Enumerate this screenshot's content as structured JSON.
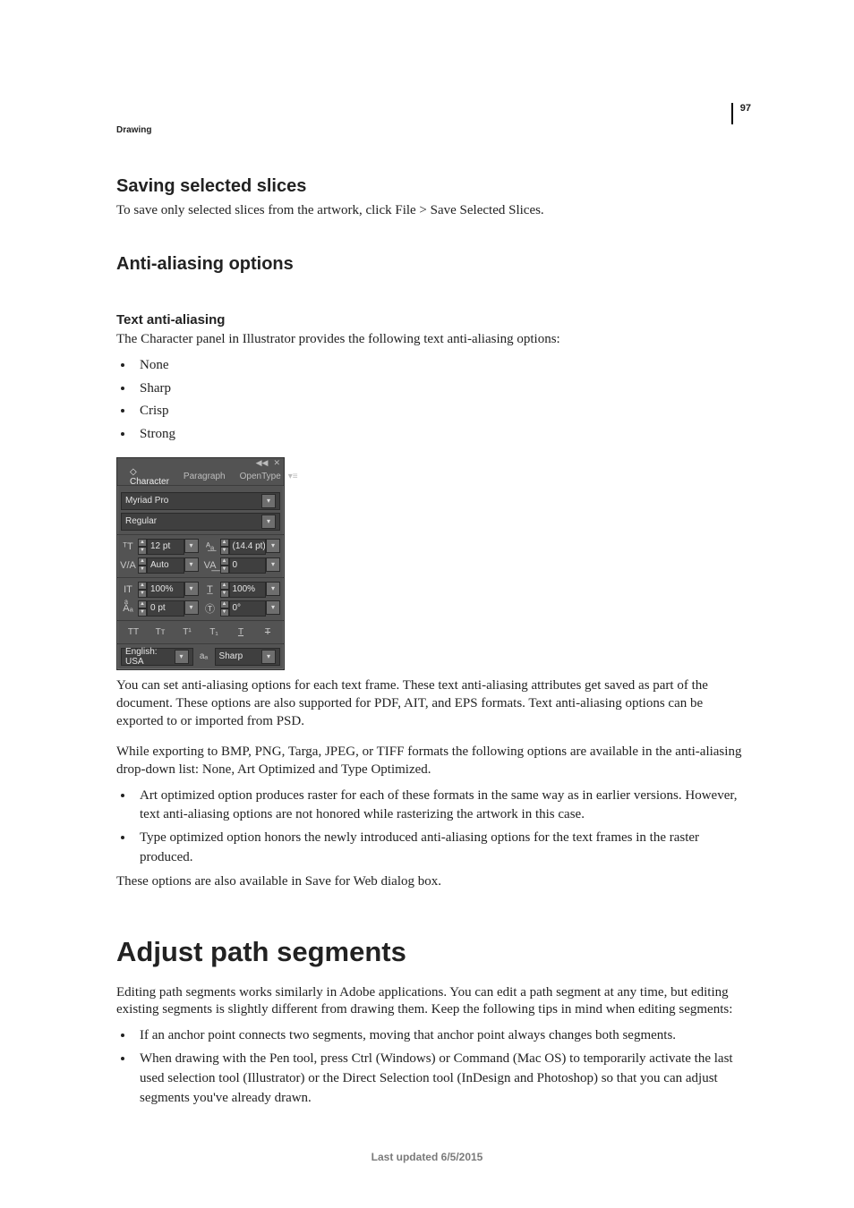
{
  "page": {
    "number": "97",
    "breadcrumb": "Drawing",
    "footer": "Last updated 6/5/2015"
  },
  "section1": {
    "heading": "Saving selected slices",
    "body": "To save only selected slices from the artwork, click File > Save Selected Slices."
  },
  "section2": {
    "heading": "Anti-aliasing options",
    "sub_heading": "Text anti-aliasing",
    "intro": "The Character panel in Illustrator provides the following text anti-aliasing options:",
    "options": [
      "None",
      "Sharp",
      "Crisp",
      "Strong"
    ],
    "para1": "You can set anti-aliasing options for each text frame. These text anti-aliasing attributes get saved as part of the document. These options are also supported for PDF, AIT, and EPS formats. Text anti-aliasing options can be exported to or imported from PSD.",
    "para2": "While exporting to BMP, PNG, Targa, JPEG, or TIFF formats the following options are available in the anti-aliasing drop-down list: None, Art Optimized and Type Optimized.",
    "export_bullets": [
      "Art optimized option produces raster for each of these formats in the same way as in earlier versions. However, text anti-aliasing options are not honored while rasterizing the artwork in this case.",
      "Type optimized option honors the newly introduced anti-aliasing options for the text frames in the raster produced."
    ],
    "para3": "These options are also available in Save for Web dialog box."
  },
  "chapter": {
    "title": "Adjust path segments",
    "intro": "Editing path segments works similarly in Adobe applications. You can edit a path segment at any time, but editing existing segments is slightly different from drawing them. Keep the following tips in mind when editing segments:",
    "bullets": [
      "If an anchor point connects two segments, moving that anchor point always changes both segments.",
      "When drawing with the Pen tool, press Ctrl (Windows) or Command (Mac OS) to temporarily activate the last used selection tool (Illustrator) or the Direct Selection tool (InDesign and Photoshop) so that you can adjust segments you've already drawn."
    ]
  },
  "panel": {
    "tabs": {
      "character": "Character",
      "paragraph": "Paragraph",
      "opentype": "OpenType"
    },
    "font_family": "Myriad Pro",
    "font_style": "Regular",
    "font_size": "12 pt",
    "leading": "(14.4 pt)",
    "kerning": "Auto",
    "tracking": "0",
    "vert_scale": "100%",
    "horiz_scale": "100%",
    "baseline": "0 pt",
    "rotation": "0°",
    "allcaps": "TT",
    "smallcaps": "Tᴛ",
    "superscript": "T¹",
    "subscript": "T₁",
    "underline": "T",
    "strike": "T",
    "language": "English: USA",
    "aa_label": "aₐ",
    "antialias": "Sharp"
  }
}
